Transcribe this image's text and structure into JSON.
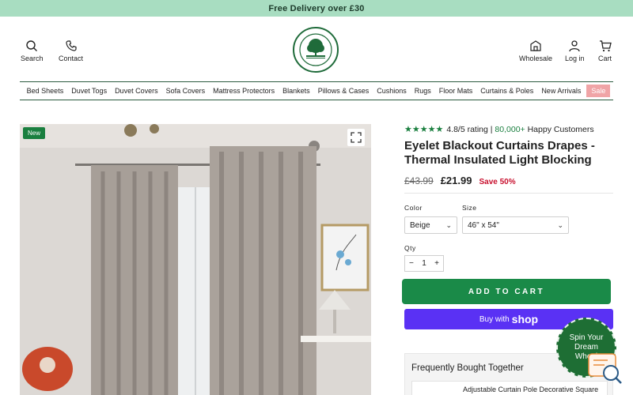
{
  "topbar": {
    "text": "Free Delivery over £30"
  },
  "header": {
    "search_label": "Search",
    "contact_label": "Contact",
    "wholesale_label": "Wholesale",
    "login_label": "Log in",
    "cart_label": "Cart",
    "logo_text_top": "THE YORKSHIRE",
    "logo_text_bottom": "BEDDING COMPANY"
  },
  "nav": {
    "items": [
      "Bed Sheets",
      "Duvet Togs",
      "Duvet Covers",
      "Sofa Covers",
      "Mattress Protectors",
      "Blankets",
      "Pillows & Cases",
      "Cushions",
      "Rugs",
      "Floor Mats",
      "Curtains & Poles",
      "New Arrivals"
    ],
    "sale": "Sale"
  },
  "gallery": {
    "badge": "New"
  },
  "product": {
    "stars": "★★★★★",
    "rating_text": "4.8/5 rating |",
    "customers_text": "80,000+",
    "customers_suffix": "Happy Customers",
    "title": "Eyelet Blackout Curtains Drapes - Thermal Insulated Light Blocking",
    "old_price": "£43.99",
    "new_price": "£21.99",
    "save": "Save 50%",
    "color_label": "Color",
    "color_value": "Beige",
    "size_label": "Size",
    "size_value": "46\" x 54\"",
    "qty_label": "Qty",
    "qty_minus": "−",
    "qty_value": "1",
    "qty_plus": "+",
    "add_to_cart": "ADD TO CART",
    "shop_prefix": "Buy with",
    "shop_brand": "shop"
  },
  "fbt": {
    "title": "Frequently Bought Together",
    "item": "Adjustable Curtain Pole Decorative Square"
  },
  "spin": {
    "line1": "Spin Your",
    "line2": "Dream",
    "line3": "Wheel"
  },
  "colors": {
    "brand_green": "#1a8a48",
    "topbar": "#a8ddc1",
    "shop_purple": "#5a31f4",
    "sale_pink": "#f0a4a6",
    "save_red": "#c8102e"
  }
}
